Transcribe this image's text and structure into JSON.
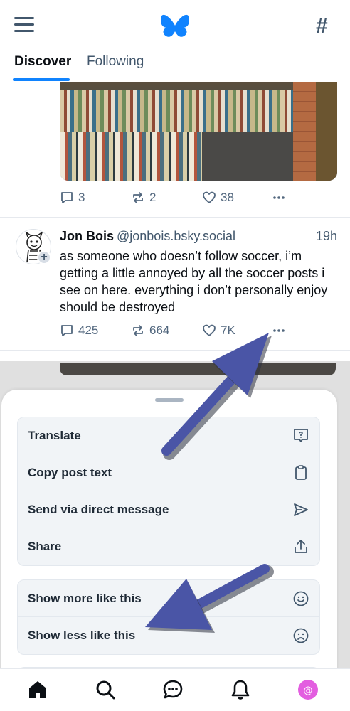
{
  "header": {
    "logo": "butterfly-logo",
    "tabs": [
      {
        "label": "Discover",
        "active": true
      },
      {
        "label": "Following",
        "active": false
      }
    ]
  },
  "prev_post": {
    "actions": {
      "replies": "3",
      "reposts": "2",
      "likes": "38"
    }
  },
  "post": {
    "author": "Jon Bois",
    "handle": "@jonbois.bsky.social",
    "time": "19h",
    "text": "as someone who doesn’t follow soccer, i’m getting a little annoyed by all the soccer posts i see on here. everything i don’t personally enjoy should be destroyed",
    "actions": {
      "replies": "425",
      "reposts": "664",
      "likes": "7K"
    }
  },
  "sheet": {
    "group1": [
      {
        "label": "Translate",
        "icon": "translate-icon"
      },
      {
        "label": "Copy post text",
        "icon": "clipboard-icon"
      },
      {
        "label": "Send via direct message",
        "icon": "send-icon"
      },
      {
        "label": "Share",
        "icon": "share-icon"
      }
    ],
    "group2": [
      {
        "label": "Show more like this",
        "icon": "smile-icon"
      },
      {
        "label": "Show less like this",
        "icon": "frown-icon"
      }
    ]
  },
  "colors": {
    "accent": "#1083fe",
    "annotation_arrow": "#4a55a6",
    "avatar_badge": "#e35ee0"
  }
}
